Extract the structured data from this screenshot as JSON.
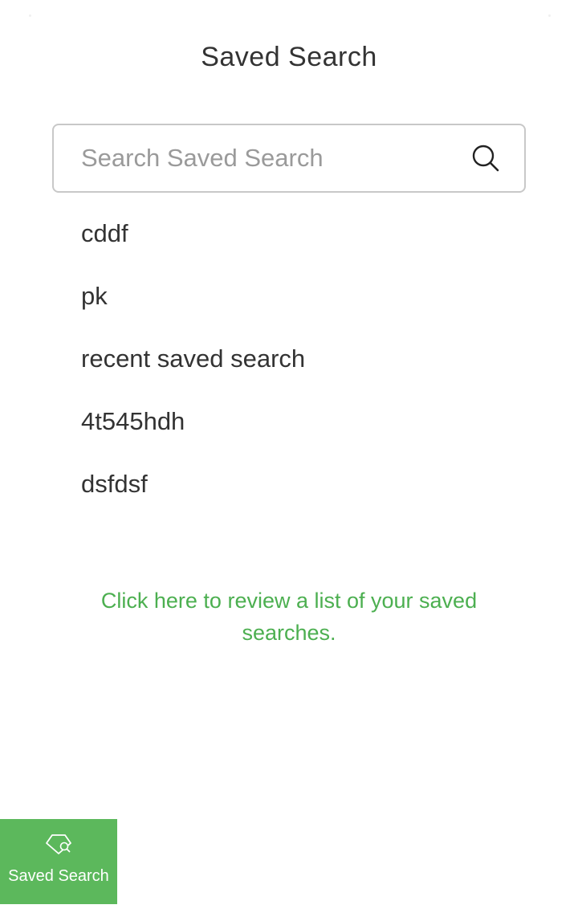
{
  "header": {
    "title": "Saved Search"
  },
  "search": {
    "placeholder": "Search Saved Search",
    "value": "",
    "icon": "search-icon"
  },
  "saved_searches": [
    {
      "label": "cddf"
    },
    {
      "label": "pk"
    },
    {
      "label": "recent saved search"
    },
    {
      "label": "4t545hdh"
    },
    {
      "label": "dsfdsf"
    }
  ],
  "review_link": {
    "text": "Click here to review a list of your saved searches."
  },
  "saved_search_button": {
    "label": "Saved Search",
    "icon": "tag-search-icon"
  },
  "colors": {
    "accent_green": "#5cb85c",
    "link_green": "#4caf50",
    "text": "#333333",
    "border": "#c8c8c8"
  }
}
